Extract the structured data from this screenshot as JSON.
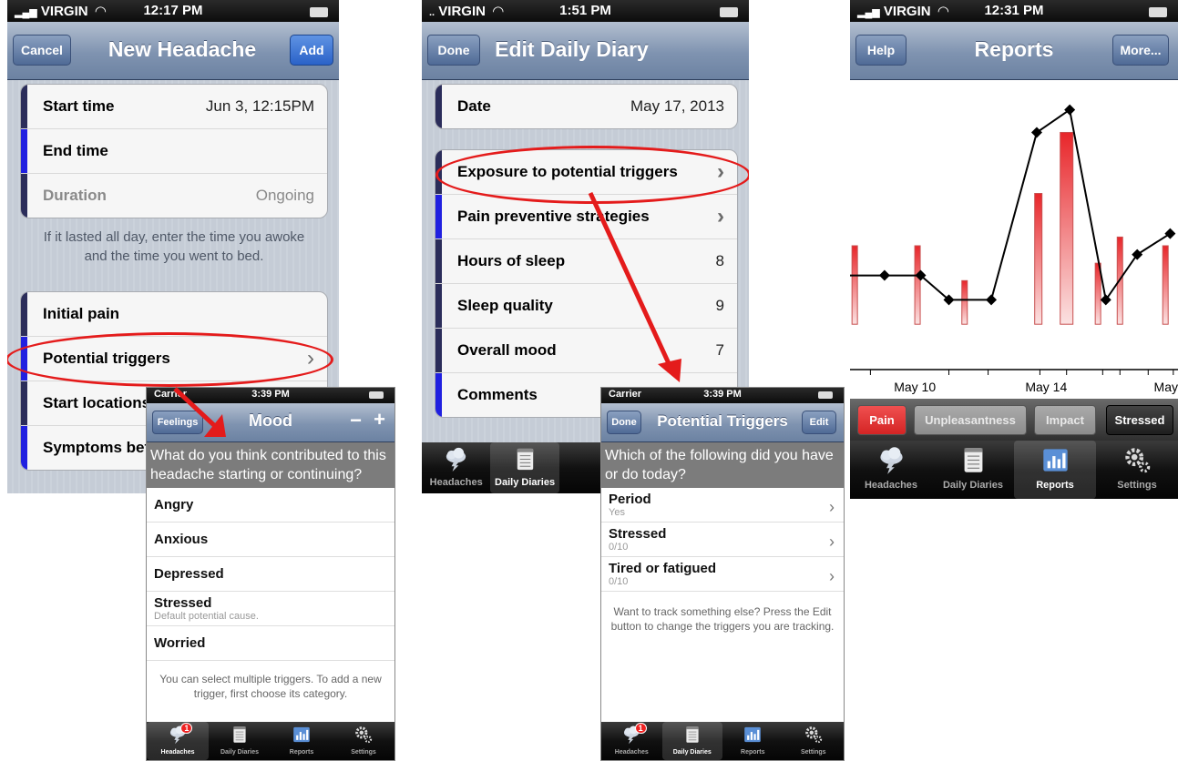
{
  "screen1": {
    "status": {
      "carrier": "VIRGIN",
      "time": "12:17 PM"
    },
    "nav": {
      "title": "New Headache",
      "cancel": "Cancel",
      "add": "Add"
    },
    "group1": [
      {
        "label": "Start time",
        "value": "Jun 3, 12:15PM",
        "bar_color": "#2b2d5a"
      },
      {
        "label": "End time",
        "value": "",
        "bar_color": "#2020e0"
      },
      {
        "label": "Duration",
        "value": "Ongoing",
        "bar_color": "#2b2d5a"
      }
    ],
    "note": "If it lasted all day, enter the time you awoke and the time you went to bed.",
    "group2": [
      {
        "label": "Initial pain",
        "bar_color": "#2b2d5a"
      },
      {
        "label": "Potential triggers",
        "bar_color": "#2020e0"
      },
      {
        "label": "Start locations",
        "bar_color": "#2b2d5a"
      },
      {
        "label": "Symptoms bef",
        "bar_color": "#2020e0"
      }
    ]
  },
  "mood_popup": {
    "status": {
      "carrier": "Carrier",
      "time": "3:39 PM"
    },
    "nav": {
      "back": "Feelings",
      "title": "Mood",
      "minus": "−",
      "plus": "+"
    },
    "prompt": "What do you think contributed to this headache starting or continuing?",
    "items": [
      {
        "label": "Angry",
        "sub": ""
      },
      {
        "label": "Anxious",
        "sub": ""
      },
      {
        "label": "Depressed",
        "sub": ""
      },
      {
        "label": "Stressed",
        "sub": "Default potential cause."
      },
      {
        "label": "Worried",
        "sub": ""
      }
    ],
    "note": "You can select multiple triggers. To add a new trigger, first choose its category.",
    "tabs": [
      {
        "label": "Headaches",
        "icon": "cloud-lightning-icon",
        "badge": "1"
      },
      {
        "label": "Daily Diaries",
        "icon": "notepad-icon"
      },
      {
        "label": "Reports",
        "icon": "bar-chart-icon"
      },
      {
        "label": "Settings",
        "icon": "gears-icon"
      }
    ]
  },
  "screen2": {
    "status": {
      "carrier": "VIRGIN",
      "time": "1:51 PM"
    },
    "nav": {
      "title": "Edit Daily Diary",
      "done": "Done"
    },
    "date_row": {
      "label": "Date",
      "value": "May 17, 2013",
      "bar_color": "#2b2d5a"
    },
    "rows": [
      {
        "label": "Exposure to potential triggers",
        "value": ">",
        "bar_color": "#2b2d5a"
      },
      {
        "label": "Pain preventive strategies",
        "value": ">",
        "bar_color": "#2020e0"
      },
      {
        "label": "Hours of sleep",
        "value": "8",
        "bar_color": "#2b2d5a"
      },
      {
        "label": "Sleep quality",
        "value": "9",
        "bar_color": "#2b2d5a"
      },
      {
        "label": "Overall mood",
        "value": "7",
        "bar_color": "#2b2d5a"
      },
      {
        "label": "Comments",
        "value": "",
        "bar_color": "#2020e0"
      }
    ],
    "tabs": [
      {
        "label": "Headaches",
        "icon": "cloud-lightning-icon"
      },
      {
        "label": "Daily Diaries",
        "icon": "notepad-icon"
      }
    ]
  },
  "triggers_popup": {
    "status": {
      "carrier": "Carrier",
      "time": "3:39 PM"
    },
    "nav": {
      "done": "Done",
      "title": "Potential Triggers",
      "edit": "Edit"
    },
    "prompt": "Which of the following did you have or do today?",
    "items": [
      {
        "label": "Period",
        "sub": "Yes"
      },
      {
        "label": "Stressed",
        "sub": "0/10"
      },
      {
        "label": "Tired or fatigued",
        "sub": "0/10"
      }
    ],
    "note": "Want to track something else? Press the Edit button to change the triggers you are tracking.",
    "tabs": [
      {
        "label": "Headaches",
        "icon": "cloud-lightning-icon",
        "badge": "1"
      },
      {
        "label": "Daily Diaries",
        "icon": "notepad-icon"
      },
      {
        "label": "Reports",
        "icon": "bar-chart-icon"
      },
      {
        "label": "Settings",
        "icon": "gears-icon"
      }
    ]
  },
  "screen3": {
    "status": {
      "carrier": "VIRGIN",
      "time": "12:31 PM"
    },
    "nav": {
      "title": "Reports",
      "help": "Help",
      "more": "More..."
    },
    "segments": [
      {
        "label": "Pain",
        "color": "#d42424"
      },
      {
        "label": "Unpleasantness",
        "color": "#8c8c8c"
      },
      {
        "label": "Impact",
        "color": "#8c8c8c"
      },
      {
        "label": "Stressed",
        "color": "#1e1e1e"
      }
    ],
    "tabs": [
      {
        "label": "Headaches",
        "icon": "cloud-lightning-icon"
      },
      {
        "label": "Daily Diaries",
        "icon": "notepad-icon"
      },
      {
        "label": "Reports",
        "icon": "bar-chart-icon"
      },
      {
        "label": "Settings",
        "icon": "gears-icon"
      }
    ]
  },
  "chart_data": {
    "type": "bar",
    "x_tick_labels": [
      "May 10",
      "May 14",
      "May"
    ],
    "bars": [
      {
        "x": 0.0,
        "value": 4.5
      },
      {
        "x": 4.0,
        "value": 4.5
      },
      {
        "x": 7.0,
        "value": 2.5
      },
      {
        "x": 11.7,
        "value": 7.5
      },
      {
        "x": 13.5,
        "value": 11.0
      },
      {
        "x": 15.5,
        "value": 3.5
      },
      {
        "x": 16.9,
        "value": 5.0
      },
      {
        "x": 19.8,
        "value": 4.5
      }
    ],
    "series": [
      {
        "name": "Stressed",
        "points": [
          [
            1.9,
            2.8
          ],
          [
            4.2,
            2.8
          ],
          [
            6.0,
            1.4
          ],
          [
            8.7,
            1.4
          ],
          [
            11.6,
            11.0
          ],
          [
            13.7,
            12.3
          ],
          [
            16.0,
            1.4
          ],
          [
            18.0,
            4.0
          ],
          [
            20.1,
            5.2
          ]
        ]
      }
    ],
    "ylim": [
      -2.6,
      14
    ],
    "xlim": [
      -0.3,
      20.6
    ],
    "legend": "none",
    "grid": false
  }
}
